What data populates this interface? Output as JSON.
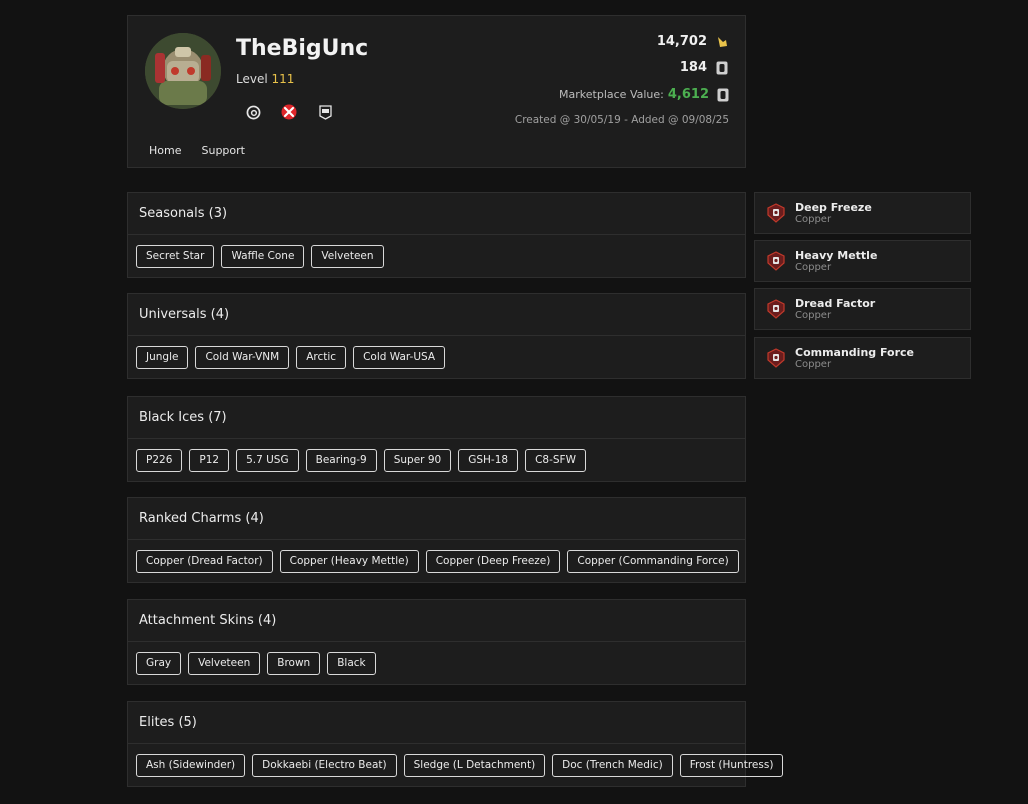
{
  "profile": {
    "username": "TheBigUnc",
    "level_label": "Level",
    "level_value": "111",
    "credits": "14,702",
    "renown": "184",
    "marketplace_label": "Marketplace Value:",
    "marketplace_value": "4,612",
    "created": "Created @ 30/05/19 - Added @ 09/08/25",
    "platforms": [
      "ubisoft-icon",
      "xbox-icon",
      "epic-games-icon"
    ],
    "colors": {
      "accent_green": "#4caf50",
      "level_gold": "#e8c24a",
      "xbox_red": "#e0262b"
    }
  },
  "nav": {
    "home": "Home",
    "support": "Support"
  },
  "sections": [
    {
      "title": "Seasonals (3)",
      "items": [
        "Secret Star",
        "Waffle Cone",
        "Velveteen"
      ]
    },
    {
      "title": "Universals (4)",
      "items": [
        "Jungle",
        "Cold War-VNM",
        "Arctic",
        "Cold War-USA"
      ]
    },
    {
      "title": "Black Ices (7)",
      "items": [
        "P226",
        "P12",
        "5.7 USG",
        "Bearing-9",
        "Super 90",
        "GSH-18",
        "C8-SFW"
      ]
    },
    {
      "title": "Ranked Charms (4)",
      "items": [
        "Copper (Dread Factor)",
        "Copper (Heavy Mettle)",
        "Copper (Deep Freeze)",
        "Copper (Commanding Force)"
      ]
    },
    {
      "title": "Attachment Skins (4)",
      "items": [
        "Gray",
        "Velveteen",
        "Brown",
        "Black"
      ]
    },
    {
      "title": "Elites (5)",
      "items": [
        "Ash (Sidewinder)",
        "Dokkaebi (Electro Beat)",
        "Sledge (L Detachment)",
        "Doc (Trench Medic)",
        "Frost (Huntress)"
      ]
    }
  ],
  "ranks": [
    {
      "season": "Deep Freeze",
      "rank": "Copper"
    },
    {
      "season": "Heavy Mettle",
      "rank": "Copper"
    },
    {
      "season": "Dread Factor",
      "rank": "Copper"
    },
    {
      "season": "Commanding Force",
      "rank": "Copper"
    }
  ]
}
